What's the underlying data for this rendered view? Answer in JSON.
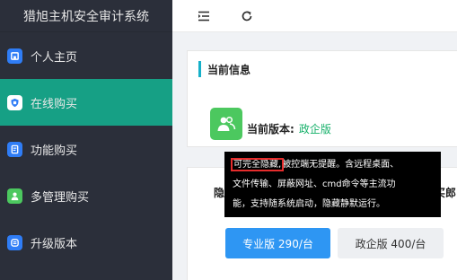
{
  "sidebar": {
    "brand": "猎旭主机安全审计系统",
    "items": [
      {
        "label": "个人主页",
        "icon": "home-icon",
        "active": false
      },
      {
        "label": "在线购买",
        "icon": "shield-icon",
        "active": true
      },
      {
        "label": "功能购买",
        "icon": "document-icon",
        "active": false
      },
      {
        "label": "多管理购买",
        "icon": "user-icon",
        "active": false
      },
      {
        "label": "升级版本",
        "icon": "upgrade-icon",
        "active": false
      }
    ]
  },
  "topbar": {
    "collapse_icon": "menu-collapse-icon",
    "refresh_icon": "refresh-icon"
  },
  "current_info": {
    "title": "当前信息",
    "version_label": "当前版本:",
    "version_value": "政企版"
  },
  "purchase_card": {
    "title_fragment_left": "隐",
    "title_fragment_right": "买郎",
    "buttons": {
      "pro": "专业版 290/台",
      "gov": "政企版 400/台"
    }
  },
  "tooltip": {
    "highlight": "可完全隐藏,",
    "line1_rest": "被控端无提醒。含远程桌面、",
    "line2": "文件传输、屏蔽网址、cmd命令等主流功",
    "line3": "能，支持随系统启动，隐藏静默运行。"
  },
  "colors": {
    "sidebar_bg": "#2b2f3a",
    "active_bg": "#16a085",
    "accent_blue": "#2e96f3",
    "version_green": "#16b06a",
    "highlight_red": "#e52c2c"
  }
}
